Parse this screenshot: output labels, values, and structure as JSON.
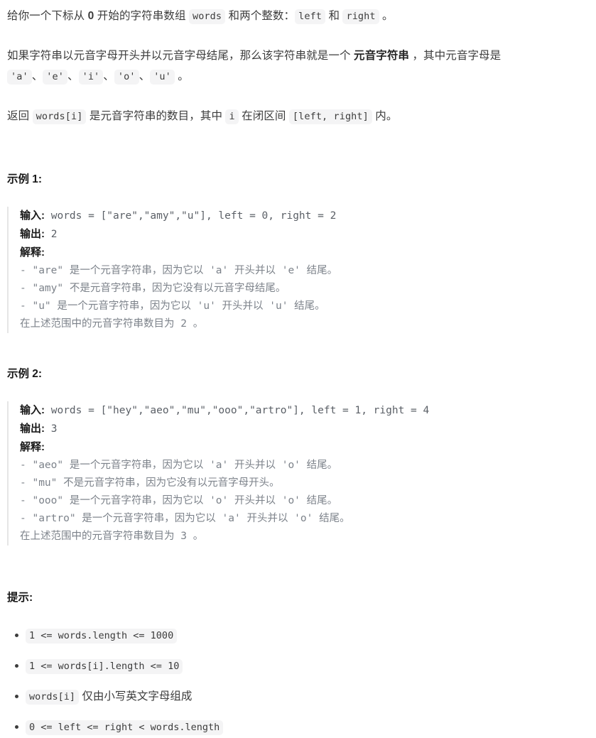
{
  "problem": {
    "intro": {
      "line1_a": "给你一个下标从 ",
      "line1_bold0": "0",
      "line1_b": " 开始的字符串数组 ",
      "line1_code_words": "words",
      "line1_c": " 和两个整数：",
      "line1_code_left": "left",
      "line1_d": " 和 ",
      "line1_code_right": "right",
      "line1_e": " 。",
      "line2_a": "如果字符串以元音字母开头并以元音字母结尾，那么该字符串就是一个 ",
      "line2_bold": "元音字符串",
      "line2_b": " ，其中元音字母是 ",
      "vowels": [
        "'a'",
        "'e'",
        "'i'",
        "'o'",
        "'u'"
      ],
      "vowel_sep": "、",
      "line2_end": " 。",
      "line3_a": "返回 ",
      "line3_code_wordsi": "words[i]",
      "line3_b": " 是元音字符串的数目，其中 ",
      "line3_code_i": "i",
      "line3_c": " 在闭区间 ",
      "line3_code_range": "[left, right]",
      "line3_d": " 内。"
    },
    "examples": [
      {
        "title": "示例 1:",
        "input_label": "输入:",
        "input_value": " words = [\"are\",\"amy\",\"u\"], left = 0, right = 2",
        "output_label": "输出:",
        "output_value": " 2",
        "explain_label": "解释:",
        "explain_lines": [
          "- \"are\" 是一个元音字符串，因为它以 'a' 开头并以 'e' 结尾。",
          "- \"amy\" 不是元音字符串，因为它没有以元音字母结尾。",
          "- \"u\" 是一个元音字符串，因为它以 'u' 开头并以 'u' 结尾。",
          "在上述范围中的元音字符串数目为 2 。"
        ]
      },
      {
        "title": "示例 2:",
        "input_label": "输入:",
        "input_value": " words = [\"hey\",\"aeo\",\"mu\",\"ooo\",\"artro\"], left = 1, right = 4",
        "output_label": "输出:",
        "output_value": " 3",
        "explain_label": "解释:",
        "explain_lines": [
          "- \"aeo\" 是一个元音字符串，因为它以 'a' 开头并以 'o' 结尾。",
          "- \"mu\" 不是元音字符串，因为它没有以元音字母开头。",
          "- \"ooo\" 是一个元音字符串，因为它以 'o' 开头并以 'o' 结尾。",
          "- \"artro\" 是一个元音字符串，因为它以 'a' 开头并以 'o' 结尾。",
          "在上述范围中的元音字符串数目为 3 。"
        ]
      }
    ],
    "constraints": {
      "title": "提示:",
      "items": [
        {
          "code": "1 <= words.length <= 1000",
          "text": ""
        },
        {
          "code": "1 <= words[i].length <= 10",
          "text": ""
        },
        {
          "code": "words[i]",
          "text": " 仅由小写英文字母组成"
        },
        {
          "code": "0 <= left <= right < words.length",
          "text": ""
        }
      ]
    }
  },
  "colors": {
    "text": "#3c3c3c",
    "heading": "#1a1a1a",
    "code_bg": "#f4f4f5",
    "explain": "#7c828a",
    "border": "#e5e5e5"
  }
}
